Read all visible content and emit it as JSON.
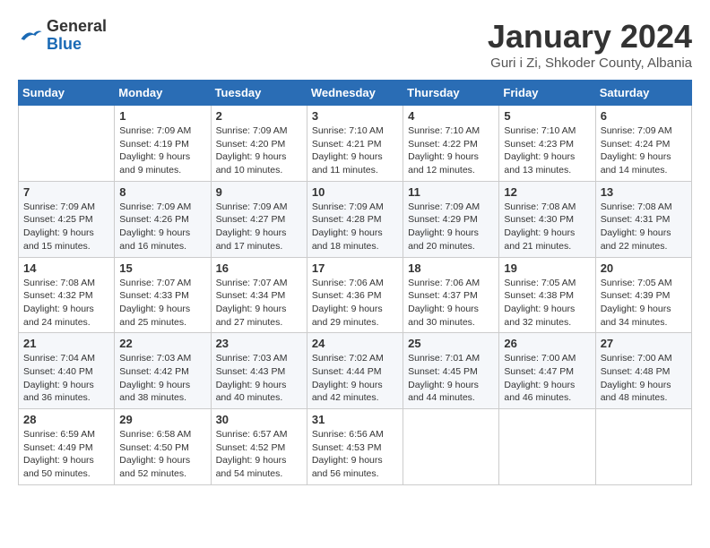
{
  "logo": {
    "general": "General",
    "blue": "Blue"
  },
  "header": {
    "title": "January 2024",
    "location": "Guri i Zi, Shkoder County, Albania"
  },
  "weekdays": [
    "Sunday",
    "Monday",
    "Tuesday",
    "Wednesday",
    "Thursday",
    "Friday",
    "Saturday"
  ],
  "weeks": [
    [
      {
        "day": "",
        "sunrise": "",
        "sunset": "",
        "daylight": ""
      },
      {
        "day": "1",
        "sunrise": "Sunrise: 7:09 AM",
        "sunset": "Sunset: 4:19 PM",
        "daylight": "Daylight: 9 hours and 9 minutes."
      },
      {
        "day": "2",
        "sunrise": "Sunrise: 7:09 AM",
        "sunset": "Sunset: 4:20 PM",
        "daylight": "Daylight: 9 hours and 10 minutes."
      },
      {
        "day": "3",
        "sunrise": "Sunrise: 7:10 AM",
        "sunset": "Sunset: 4:21 PM",
        "daylight": "Daylight: 9 hours and 11 minutes."
      },
      {
        "day": "4",
        "sunrise": "Sunrise: 7:10 AM",
        "sunset": "Sunset: 4:22 PM",
        "daylight": "Daylight: 9 hours and 12 minutes."
      },
      {
        "day": "5",
        "sunrise": "Sunrise: 7:10 AM",
        "sunset": "Sunset: 4:23 PM",
        "daylight": "Daylight: 9 hours and 13 minutes."
      },
      {
        "day": "6",
        "sunrise": "Sunrise: 7:09 AM",
        "sunset": "Sunset: 4:24 PM",
        "daylight": "Daylight: 9 hours and 14 minutes."
      }
    ],
    [
      {
        "day": "7",
        "sunrise": "Sunrise: 7:09 AM",
        "sunset": "Sunset: 4:25 PM",
        "daylight": "Daylight: 9 hours and 15 minutes."
      },
      {
        "day": "8",
        "sunrise": "Sunrise: 7:09 AM",
        "sunset": "Sunset: 4:26 PM",
        "daylight": "Daylight: 9 hours and 16 minutes."
      },
      {
        "day": "9",
        "sunrise": "Sunrise: 7:09 AM",
        "sunset": "Sunset: 4:27 PM",
        "daylight": "Daylight: 9 hours and 17 minutes."
      },
      {
        "day": "10",
        "sunrise": "Sunrise: 7:09 AM",
        "sunset": "Sunset: 4:28 PM",
        "daylight": "Daylight: 9 hours and 18 minutes."
      },
      {
        "day": "11",
        "sunrise": "Sunrise: 7:09 AM",
        "sunset": "Sunset: 4:29 PM",
        "daylight": "Daylight: 9 hours and 20 minutes."
      },
      {
        "day": "12",
        "sunrise": "Sunrise: 7:08 AM",
        "sunset": "Sunset: 4:30 PM",
        "daylight": "Daylight: 9 hours and 21 minutes."
      },
      {
        "day": "13",
        "sunrise": "Sunrise: 7:08 AM",
        "sunset": "Sunset: 4:31 PM",
        "daylight": "Daylight: 9 hours and 22 minutes."
      }
    ],
    [
      {
        "day": "14",
        "sunrise": "Sunrise: 7:08 AM",
        "sunset": "Sunset: 4:32 PM",
        "daylight": "Daylight: 9 hours and 24 minutes."
      },
      {
        "day": "15",
        "sunrise": "Sunrise: 7:07 AM",
        "sunset": "Sunset: 4:33 PM",
        "daylight": "Daylight: 9 hours and 25 minutes."
      },
      {
        "day": "16",
        "sunrise": "Sunrise: 7:07 AM",
        "sunset": "Sunset: 4:34 PM",
        "daylight": "Daylight: 9 hours and 27 minutes."
      },
      {
        "day": "17",
        "sunrise": "Sunrise: 7:06 AM",
        "sunset": "Sunset: 4:36 PM",
        "daylight": "Daylight: 9 hours and 29 minutes."
      },
      {
        "day": "18",
        "sunrise": "Sunrise: 7:06 AM",
        "sunset": "Sunset: 4:37 PM",
        "daylight": "Daylight: 9 hours and 30 minutes."
      },
      {
        "day": "19",
        "sunrise": "Sunrise: 7:05 AM",
        "sunset": "Sunset: 4:38 PM",
        "daylight": "Daylight: 9 hours and 32 minutes."
      },
      {
        "day": "20",
        "sunrise": "Sunrise: 7:05 AM",
        "sunset": "Sunset: 4:39 PM",
        "daylight": "Daylight: 9 hours and 34 minutes."
      }
    ],
    [
      {
        "day": "21",
        "sunrise": "Sunrise: 7:04 AM",
        "sunset": "Sunset: 4:40 PM",
        "daylight": "Daylight: 9 hours and 36 minutes."
      },
      {
        "day": "22",
        "sunrise": "Sunrise: 7:03 AM",
        "sunset": "Sunset: 4:42 PM",
        "daylight": "Daylight: 9 hours and 38 minutes."
      },
      {
        "day": "23",
        "sunrise": "Sunrise: 7:03 AM",
        "sunset": "Sunset: 4:43 PM",
        "daylight": "Daylight: 9 hours and 40 minutes."
      },
      {
        "day": "24",
        "sunrise": "Sunrise: 7:02 AM",
        "sunset": "Sunset: 4:44 PM",
        "daylight": "Daylight: 9 hours and 42 minutes."
      },
      {
        "day": "25",
        "sunrise": "Sunrise: 7:01 AM",
        "sunset": "Sunset: 4:45 PM",
        "daylight": "Daylight: 9 hours and 44 minutes."
      },
      {
        "day": "26",
        "sunrise": "Sunrise: 7:00 AM",
        "sunset": "Sunset: 4:47 PM",
        "daylight": "Daylight: 9 hours and 46 minutes."
      },
      {
        "day": "27",
        "sunrise": "Sunrise: 7:00 AM",
        "sunset": "Sunset: 4:48 PM",
        "daylight": "Daylight: 9 hours and 48 minutes."
      }
    ],
    [
      {
        "day": "28",
        "sunrise": "Sunrise: 6:59 AM",
        "sunset": "Sunset: 4:49 PM",
        "daylight": "Daylight: 9 hours and 50 minutes."
      },
      {
        "day": "29",
        "sunrise": "Sunrise: 6:58 AM",
        "sunset": "Sunset: 4:50 PM",
        "daylight": "Daylight: 9 hours and 52 minutes."
      },
      {
        "day": "30",
        "sunrise": "Sunrise: 6:57 AM",
        "sunset": "Sunset: 4:52 PM",
        "daylight": "Daylight: 9 hours and 54 minutes."
      },
      {
        "day": "31",
        "sunrise": "Sunrise: 6:56 AM",
        "sunset": "Sunset: 4:53 PM",
        "daylight": "Daylight: 9 hours and 56 minutes."
      },
      {
        "day": "",
        "sunrise": "",
        "sunset": "",
        "daylight": ""
      },
      {
        "day": "",
        "sunrise": "",
        "sunset": "",
        "daylight": ""
      },
      {
        "day": "",
        "sunrise": "",
        "sunset": "",
        "daylight": ""
      }
    ]
  ]
}
